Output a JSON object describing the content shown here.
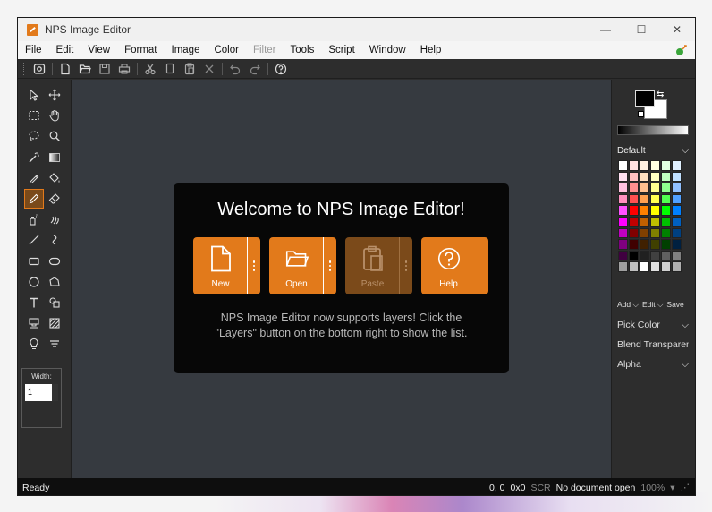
{
  "window": {
    "title": "NPS Image Editor",
    "controls": {
      "minimize": "—",
      "maximize": "☐",
      "close": "✕"
    }
  },
  "menu": {
    "items": [
      {
        "label": "File",
        "disabled": false
      },
      {
        "label": "Edit",
        "disabled": false
      },
      {
        "label": "View",
        "disabled": false
      },
      {
        "label": "Format",
        "disabled": false
      },
      {
        "label": "Image",
        "disabled": false
      },
      {
        "label": "Color",
        "disabled": false
      },
      {
        "label": "Filter",
        "disabled": true
      },
      {
        "label": "Tools",
        "disabled": false
      },
      {
        "label": "Script",
        "disabled": false
      },
      {
        "label": "Window",
        "disabled": false
      },
      {
        "label": "Help",
        "disabled": false
      }
    ]
  },
  "welcome": {
    "title": "Welcome to NPS Image Editor!",
    "buttons": [
      {
        "label": "New"
      },
      {
        "label": "Open"
      },
      {
        "label": "Paste"
      },
      {
        "label": "Help"
      }
    ],
    "message_line1": "NPS Image Editor now supports layers! Click the",
    "message_line2": "\"Layers\" button on the bottom right to show the list."
  },
  "tools": {
    "width_label": "Width:",
    "width_value": "1"
  },
  "right_panel": {
    "palette_name": "Default",
    "add_label": "Add",
    "edit_label": "Edit",
    "save_label": "Save",
    "pick_color": "Pick Color",
    "blend": "Blend Transparent",
    "alpha": "Alpha"
  },
  "status": {
    "ready": "Ready",
    "coords": "0, 0",
    "size": "0x0",
    "scr": "SCR",
    "document": "No document open",
    "zoom": "100%"
  },
  "colors": {
    "accent": "#e27a1b",
    "panel": "#2d2d2d",
    "canvas": "#363a40"
  }
}
